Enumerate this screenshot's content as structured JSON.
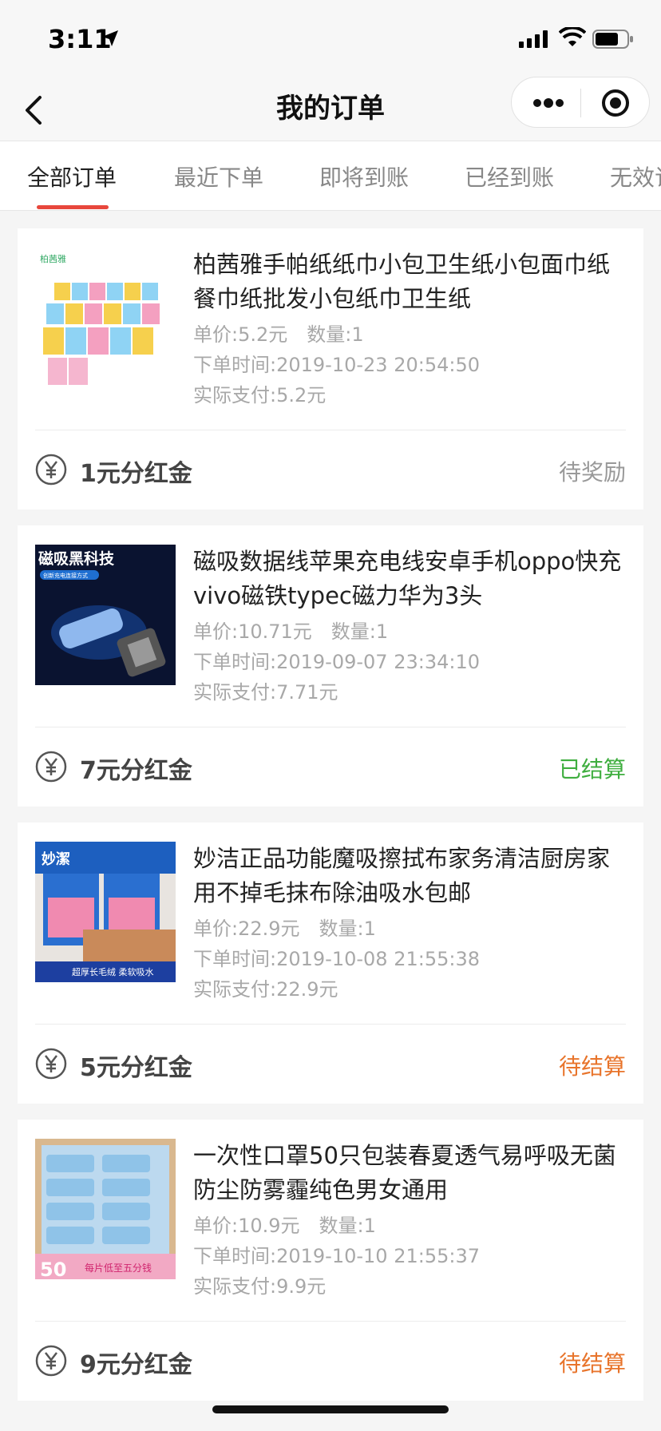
{
  "status_bar": {
    "time": "3:11"
  },
  "nav": {
    "title": "我的订单"
  },
  "tabs": [
    {
      "label": "全部订单",
      "active": true
    },
    {
      "label": "最近下单"
    },
    {
      "label": "即将到账"
    },
    {
      "label": "已经到账"
    },
    {
      "label": "无效订"
    }
  ],
  "orders": [
    {
      "title": "柏茜雅手帕纸纸巾小包卫生纸小包面巾纸餐巾纸批发小包纸巾卫生纸",
      "price": "单价:5.2元",
      "qty": "数量:1",
      "order_time": "下单时间:2019-10-23 20:54:50",
      "paid": "实际支付:5.2元",
      "reward": "1元分红金",
      "status": "待奖励",
      "status_color": "#999999",
      "thumb_label": "柏茜雅"
    },
    {
      "title": "磁吸数据线苹果充电线安卓手机oppo快充vivo磁铁typec磁力华为3头",
      "price": "单价:10.71元",
      "qty": "数量:1",
      "order_time": "下单时间:2019-09-07 23:34:10",
      "paid": "实际支付:7.71元",
      "reward": "7元分红金",
      "status": "已结算",
      "status_color": "#3fae3f",
      "thumb_label": "磁吸黑科技",
      "thumb_sublabel": "创新充电连接方式"
    },
    {
      "title": "妙洁正品功能魔吸擦拭布家务清洁厨房家用不掉毛抹布除油吸水包邮",
      "price": "单价:22.9元",
      "qty": "数量:1",
      "order_time": "下单时间:2019-10-08 21:55:38",
      "paid": "实际支付:22.9元",
      "reward": "5元分红金",
      "status": "待结算",
      "status_color": "#e8742b",
      "thumb_label": "妙潔",
      "thumb_sublabel": "超厚长毛绒 柔软吸水"
    },
    {
      "title": "一次性口罩50只包装春夏透气易呼吸无菌防尘防雾霾纯色男女通用",
      "price": "单价:10.9元",
      "qty": "数量:1",
      "order_time": "下单时间:2019-10-10 21:55:37",
      "paid": "实际支付:9.9元",
      "reward": "9元分红金",
      "status": "待结算",
      "status_color": "#e8742b",
      "thumb_label": "50",
      "thumb_sublabel": "每片低至五分钱"
    }
  ],
  "colors": {
    "accent": "#e8473c"
  }
}
